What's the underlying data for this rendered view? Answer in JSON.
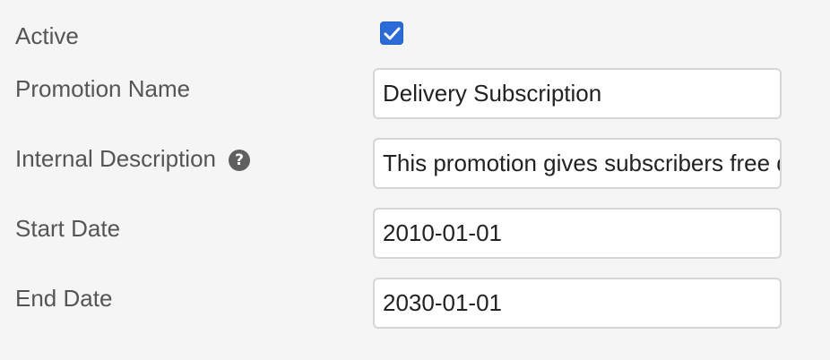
{
  "form": {
    "active": {
      "label": "Active",
      "checked": true
    },
    "promotion_name": {
      "label": "Promotion Name",
      "value": "Delivery Subscription"
    },
    "internal_description": {
      "label": "Internal Description",
      "help_icon": "question-circle-icon",
      "help_glyph": "?",
      "value": "This promotion gives subscribers free delivery"
    },
    "start_date": {
      "label": "Start Date",
      "value": "2010-01-01"
    },
    "end_date": {
      "label": "End Date",
      "value": "2030-01-01"
    }
  },
  "colors": {
    "background": "#f5f5f5",
    "checkbox_accent": "#2a6bd6",
    "label_text": "#555555",
    "input_border": "#d6d6d6"
  }
}
